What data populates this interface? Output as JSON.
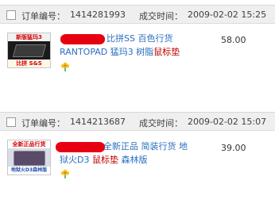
{
  "orders": [
    {
      "order_label": "订单编号：",
      "order_number": "1414281993",
      "time_label": "成交时间：",
      "time": "2009-02-02 15:25",
      "thumb_top_text": "新版猛玛3",
      "thumb_bottom_text": "比拼 S&S",
      "title_line1": "比拼SS 百色行货",
      "title_line2_plain": "RANTOPAD 猛玛3 树脂",
      "title_line2_highlight": "鼠标垫",
      "price": "58.00"
    },
    {
      "order_label": "订单编号：",
      "order_number": "1414213687",
      "time_label": "成交时间：",
      "time": "2009-02-02 15:07",
      "thumb_top_text": "全新正品行货",
      "thumb_bottom_text": "地狱火D3森林版",
      "title_line1": "全新正品 简装行货 地",
      "title_line2_plain": "狱火D3 ",
      "title_line2_highlight": "鼠标垫",
      "title_line2_tail": " 森林版",
      "price": "39.00"
    }
  ],
  "colors": {
    "header_bg": "#efefef",
    "title_link": "#2a6fc0",
    "highlight": "#c00000",
    "redaction": "#e60012"
  },
  "icons": {
    "status": "flower-icon"
  }
}
